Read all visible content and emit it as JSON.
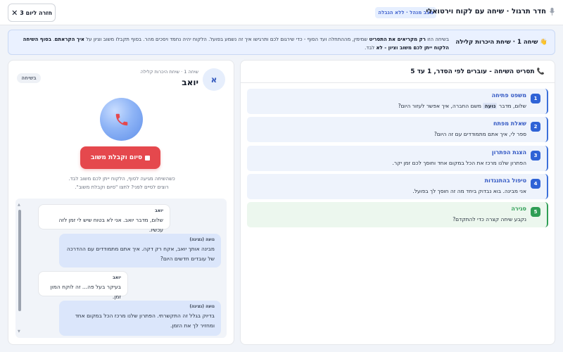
{
  "topbar": {
    "title": "חדר תרגול · שיחה עם לקוח וירטואלי",
    "mode_badge": "מצב מנהל · ללא הגבלה",
    "back_label": "חזרה ליום 3"
  },
  "banner": {
    "title": "👋 שיחה 1 · שיחת היכרות קלילה",
    "text_prefix": "בשיחה הזו ",
    "text_bold1": "רק מקריאים את התסריט",
    "text_mid": " שמימין, מההתחלה ועד הסוף - כדי שירגום לכם ותרגישו איך זה נשמע בפועל. הלקוח יהיה נחמד ויסכים מהר. בסוף תקבלו משוב וציון על ",
    "text_bold2": "איך הקראתם",
    "text_mid2": ". ",
    "text_bold3": "בסוף השיחה הלקוח ייתן לכם משוב וציון - לא",
    "text_end": " לבד."
  },
  "customer": {
    "avatar_letter": "א",
    "subtitle": "שיחה 1 · שיחת היכרות קלילה",
    "name": "יואב",
    "call_status": "בשיחה"
  },
  "call": {
    "end_button_label": "סיום וקבלת משוב",
    "hint_line1": "כשהשיחה מגיעה לסוף, הלקוח ייתן לכם משוב לבד.",
    "hint_line2": "רוצים לסיים לפני? לחצו \"סיום וקבלת משוב\"."
  },
  "chat": {
    "messages": [
      {
        "role": "customer",
        "sender": "יואב",
        "text": "שלום, מדבר יואב. אני לא בטוח שיש לי זמן לזה עכשיו."
      },
      {
        "role": "agent",
        "sender": "נועה (נציגה)",
        "text": "מבינה אותך יואב, אקח רק דקה. איך אתם מתמודדים עם ההדרכה של עובדים חדשים היום?"
      },
      {
        "role": "customer",
        "sender": "יואב",
        "text": "בעיקר בעל פה... זה לוקח המון זמן."
      },
      {
        "role": "agent",
        "sender": "נועה (נציגה)",
        "text": "בדיוק בגלל זה התקשרתי. הפתרון שלנו מרכז הכל במקום אחד ומחזיר לך את הזמן."
      }
    ]
  },
  "script": {
    "title": "📞 תסריט השיחה - עוברים לפי הסדר, 1 עד 5",
    "steps": [
      {
        "num": "1",
        "title": "משפט פתיחה",
        "text_before": "שלום, מדבר ",
        "highlight": "נועה",
        "text_after": " משם החברה, איך אפשר לעזור היום?",
        "state": "active"
      },
      {
        "num": "2",
        "title": "שאלת מפתח",
        "text_before": "ספר לי, איך אתם מתמודדים עם זה היום?",
        "highlight": "",
        "text_after": "",
        "state": "active"
      },
      {
        "num": "3",
        "title": "הצגת הפתרון",
        "text_before": "הפתרון שלנו מרכז את הכל במקום אחד וחוסך לכם זמן יקר.",
        "highlight": "",
        "text_after": "",
        "state": "active"
      },
      {
        "num": "4",
        "title": "טיפול בהתנגדות",
        "text_before": "אני מבינה. בוא נבדוק ביחד מה זה חוסך לך בפועל.",
        "highlight": "",
        "text_after": "",
        "state": "active"
      },
      {
        "num": "5",
        "title": "סגירה",
        "text_before": "נקבע שיחה קצרה כדי להתקדם?",
        "highlight": "",
        "text_after": "",
        "state": "done"
      }
    ]
  },
  "colors": {
    "accent": "#2f63d6",
    "danger": "#e5484d",
    "success": "#2f9e55"
  }
}
